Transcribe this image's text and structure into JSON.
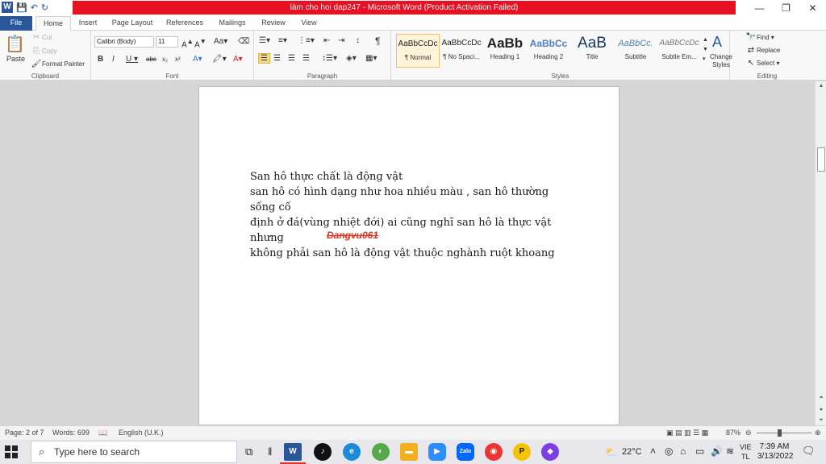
{
  "window": {
    "title": "làm cho hoi dap247 - Microsoft Word (Product Activation Failed)",
    "controls": [
      "—",
      "❐",
      "✕"
    ]
  },
  "tabs": [
    "File",
    "Home",
    "Insert",
    "Page Layout",
    "References",
    "Mailings",
    "Review",
    "View"
  ],
  "clipboard": {
    "paste": "Paste",
    "cut": "Cut",
    "copy": "Copy",
    "format_painter": "Format Painter",
    "label": "Clipboard"
  },
  "font": {
    "family": "Calibri (Body)",
    "size": "11",
    "label": "Font"
  },
  "paragraph": {
    "label": "Paragraph"
  },
  "styles": {
    "label": "Styles",
    "items": [
      {
        "preview": "AaBbCcDc",
        "name": "¶ Normal"
      },
      {
        "preview": "AaBbCcDc",
        "name": "¶ No Spaci..."
      },
      {
        "preview": "AaBb",
        "name": "Heading 1"
      },
      {
        "preview": "AaBbCc",
        "name": "Heading 2"
      },
      {
        "preview": "AaB",
        "name": "Title"
      },
      {
        "preview": "AaBbCc.",
        "name": "Subtitle"
      },
      {
        "preview": "AaBbCcDc",
        "name": "Subtle Em..."
      }
    ],
    "change_styles": "Change Styles"
  },
  "editing": {
    "find": "Find",
    "replace": "Replace",
    "select": "Select",
    "label": "Editing"
  },
  "document": {
    "lines": [
      "San hô thực chất là động vật",
      "san hô có hình dạng như hoa nhiều màu , san hô thường sống cố",
      "định ở đá(vùng nhiệt đới) ai cũng nghĩ san hô là thực vật nhưng",
      "không phải san hô là động vật thuộc nghành ruột khoang"
    ],
    "signature": "Dangvu061"
  },
  "statusbar": {
    "page": "Page: 2 of 7",
    "words": "Words: 699",
    "language": "English (U.K.)",
    "zoom": "87%"
  },
  "taskbar": {
    "search_placeholder": "Type here to search",
    "weather": "22°C",
    "lang1": "VIE",
    "lang2": "TL",
    "time": "7:39 AM",
    "date": "3/13/2022"
  }
}
